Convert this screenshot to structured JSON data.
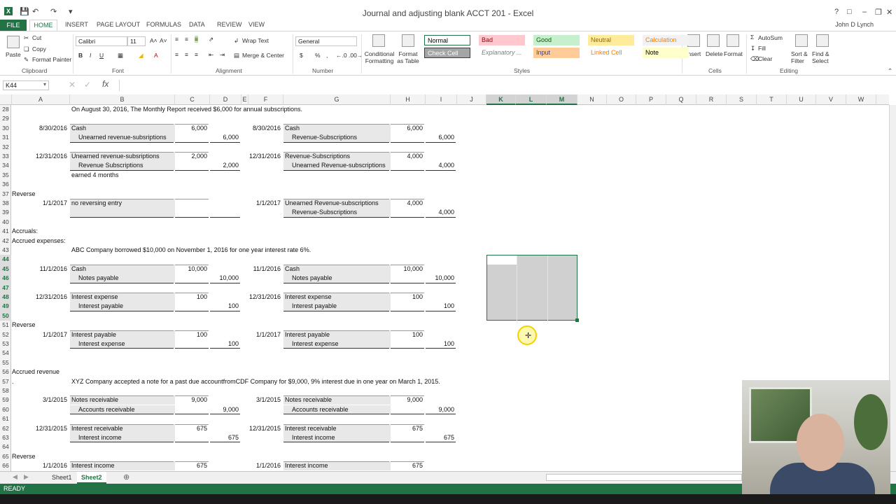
{
  "window": {
    "title": "Journal and adjusting blank ACCT 201 - Excel",
    "app_icon": "excel-icon"
  },
  "ribbon_tabs": [
    "FILE",
    "HOME",
    "INSERT",
    "PAGE LAYOUT",
    "FORMULAS",
    "DATA",
    "REVIEW",
    "VIEW"
  ],
  "user": "John D Lynch",
  "ribbon": {
    "clipboard": {
      "paste": "Paste",
      "cut": "Cut",
      "copy": "Copy",
      "format_painter": "Format Painter",
      "group": "Clipboard"
    },
    "font": {
      "name": "Calibri",
      "size": "11",
      "group": "Font"
    },
    "alignment": {
      "wrap": "Wrap Text",
      "merge": "Merge & Center",
      "group": "Alignment"
    },
    "number": {
      "format": "General",
      "group": "Number"
    },
    "styles": {
      "conditional": "Conditional Formatting",
      "format_table": "Format as Table",
      "group": "Styles",
      "cells": [
        {
          "label": "Normal",
          "bg": "#ffffff",
          "fg": "#000000"
        },
        {
          "label": "Bad",
          "bg": "#ffc7ce",
          "fg": "#9c0006"
        },
        {
          "label": "Good",
          "bg": "#c6efce",
          "fg": "#006100"
        },
        {
          "label": "Neutral",
          "bg": "#ffeb9c",
          "fg": "#9c6500"
        },
        {
          "label": "Calculation",
          "bg": "#f2f2f2",
          "fg": "#fa7d00"
        },
        {
          "label": "Check Cell",
          "bg": "#a5a5a5",
          "fg": "#ffffff"
        },
        {
          "label": "Explanatory ...",
          "bg": "#ffffff",
          "fg": "#7f7f7f"
        },
        {
          "label": "Input",
          "bg": "#ffcc99",
          "fg": "#3f3f76"
        },
        {
          "label": "Linked Cell",
          "bg": "#ffffff",
          "fg": "#fa7d00"
        },
        {
          "label": "Note",
          "bg": "#ffffcc",
          "fg": "#000000"
        }
      ]
    },
    "cells": {
      "insert": "Insert",
      "delete": "Delete",
      "format": "Format",
      "group": "Cells"
    },
    "editing": {
      "autosum": "AutoSum",
      "fill": "Fill",
      "clear": "Clear",
      "sort": "Sort & Filter",
      "find": "Find & Select",
      "group": "Editing"
    }
  },
  "name_box": "K44",
  "formula": "",
  "columns": [
    "A",
    "B",
    "C",
    "D",
    "E",
    "F",
    "G",
    "H",
    "I",
    "J",
    "K",
    "L",
    "M",
    "N",
    "O",
    "P",
    "Q",
    "R",
    "S",
    "T",
    "U",
    "V",
    "W"
  ],
  "selected_columns": [
    "K",
    "L",
    "M"
  ],
  "row_numbers": [
    28,
    29,
    30,
    31,
    32,
    33,
    34,
    35,
    36,
    37,
    38,
    39,
    40,
    41,
    42,
    43,
    44,
    45,
    46,
    47,
    48,
    49,
    50,
    51,
    52,
    53,
    54,
    55,
    56,
    57,
    58,
    59,
    60,
    61,
    62,
    63,
    64,
    65,
    66
  ],
  "selected_rows": [
    44,
    45,
    46,
    47,
    48,
    49,
    50
  ],
  "rows": {
    "r28": {
      "B": "On August 30, 2016, The Monthly Report received $6,000 for annual subscriptions."
    },
    "r30": {
      "A": "8/30/2016",
      "B": "Cash",
      "C": "6,000",
      "F": "8/30/2016",
      "G": "Cash",
      "H": "6,000"
    },
    "r31": {
      "B": "Unearned revenue-subsriptions",
      "D": "6,000",
      "G": "Revenue-Subscriptions",
      "I": "6,000"
    },
    "r33": {
      "A": "12/31/2016",
      "B": "Unearned revenue-subsriptions",
      "C": "2,000",
      "F": "12/31/2016",
      "G": "Revenue-Subscriptions",
      "H": "4,000"
    },
    "r34": {
      "B": "Revenue Subscriptions",
      "D": "2,000",
      "G": "Unearned Revenue-subscriptions",
      "I": "4,000"
    },
    "r35": {
      "B": "earned 4 months"
    },
    "r37": {
      "A": "Reverse"
    },
    "r38": {
      "A": "1/1/2017",
      "B": "no reversing entry",
      "F": "1/1/2017",
      "G": "Unearned Revenue-subscriptions",
      "H": "4,000"
    },
    "r39": {
      "G": "Revenue-Subscriptions",
      "I": "4,000"
    },
    "r41": {
      "A": "Accruals:"
    },
    "r42": {
      "A": "Accrued expenses:"
    },
    "r43": {
      "B": "ABC Company borrowed $10,000 on November 1, 2016 for one year interest rate 6%."
    },
    "r45": {
      "A": "11/1/2016",
      "B": "Cash",
      "C": "10,000",
      "F": "11/1/2016",
      "G": "Cash",
      "H": "10,000"
    },
    "r46": {
      "B": "Notes payable",
      "D": "10,000",
      "G": "Notes payable",
      "I": "10,000"
    },
    "r48": {
      "A": "12/31/2016",
      "B": "Interest expense",
      "C": "100",
      "F": "12/31/2016",
      "G": "Interest expense",
      "H": "100"
    },
    "r49": {
      "B": "Interest payable",
      "D": "100",
      "G": "Interest payable",
      "I": "100"
    },
    "r51": {
      "A": "Reverse"
    },
    "r52": {
      "A": "1/1/2017",
      "B": "Interest payable",
      "C": "100",
      "F": "1/1/2017",
      "G": "Interest payable",
      "H": "100"
    },
    "r53": {
      "B": "Interest expense",
      "D": "100",
      "G": "Interest expense",
      "I": "100"
    },
    "r56": {
      "A": "Accrued revenue"
    },
    "r57": {
      "A": ".",
      "B": "XYZ Company accepted a note for a past due accountfromCDF Company for $9,000, 9% interest  due in one year on March 1, 2015."
    },
    "r59": {
      "A": "3/1/2015",
      "B": "Notes receivable",
      "C": "9,000",
      "F": "3/1/2015",
      "G": "Notes receivable",
      "H": "9,000"
    },
    "r60": {
      "B": "Accounts receivable",
      "D": "9,000",
      "G": "Accounts receivable",
      "I": "9,000"
    },
    "r62": {
      "A": "12/31/2015",
      "B": "Interest receivable",
      "C": "675",
      "F": "12/31/2015",
      "G": "Interest receivable",
      "H": "675"
    },
    "r63": {
      "B": "Interest income",
      "D": "675",
      "G": "Interest income",
      "I": "675"
    },
    "r65": {
      "A": "Reverse"
    },
    "r66": {
      "A": "1/1/2016",
      "B": "Interest income",
      "C": "675",
      "F": "1/1/2016",
      "G": "Interest income",
      "H": "675"
    }
  },
  "sheets": [
    "Sheet1",
    "Sheet2"
  ],
  "active_sheet": "Sheet2",
  "status": "READY"
}
